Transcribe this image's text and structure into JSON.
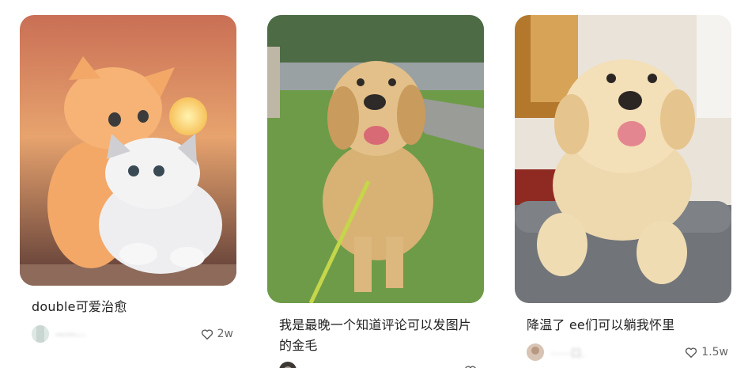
{
  "feed": {
    "cards": [
      {
        "title": "double可爱治愈",
        "author": "一一⋯",
        "likes": "2w",
        "image": "kittens-hugging-sunset"
      },
      {
        "title": "我是最晚一个知道评论可以发图片的金毛",
        "author": "",
        "likes": "",
        "image": "golden-retriever-on-leash"
      },
      {
        "title": "降温了 ee们可以躺我怀里",
        "author": "⋯⋯口.",
        "likes": "1.5w",
        "image": "golden-puppy-on-sofa"
      }
    ],
    "icons": {
      "like": "heart-outline-icon"
    }
  }
}
